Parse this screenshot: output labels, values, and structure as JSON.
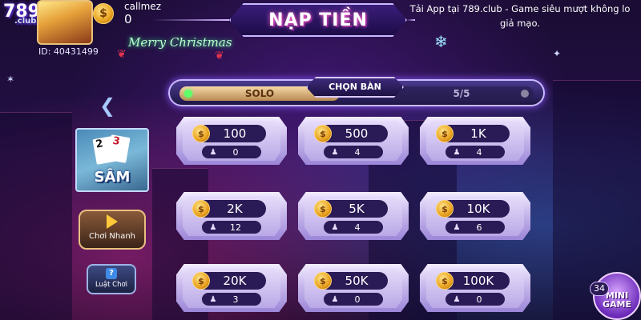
{
  "header": {
    "logo_text": "789",
    "logo_sub": ".club",
    "player_id": "ID: 40431499",
    "username": "callmez",
    "balance": "0",
    "coin_symbol": "$",
    "xmas_greeting": "Merry Christmas",
    "title": "NẠP TIỀN",
    "marquee": "Tải App tại 789.club - Game siêu mượt không lo giả mạo."
  },
  "selector": {
    "left_label": "SOLO",
    "center_label": "CHỌN BÀN",
    "right_label": "5/5"
  },
  "left_panel": {
    "game_name": "SÂM",
    "card_a": "2",
    "card_b": "3",
    "quick_play_label": "Chơi Nhanh",
    "rules_label": "Luật Chơi",
    "rules_icon_text": "?"
  },
  "rooms": [
    {
      "bet": "100",
      "players": "0"
    },
    {
      "bet": "500",
      "players": "4"
    },
    {
      "bet": "1K",
      "players": "4"
    },
    {
      "bet": "2K",
      "players": "12"
    },
    {
      "bet": "5K",
      "players": "4"
    },
    {
      "bet": "10K",
      "players": "6"
    },
    {
      "bet": "20K",
      "players": "3"
    },
    {
      "bet": "50K",
      "players": "0"
    },
    {
      "bet": "100K",
      "players": "0"
    }
  ],
  "mini_game": {
    "label_line1": "MINI",
    "label_line2": "GAME",
    "badge": "34"
  },
  "icons": {
    "back": "chevron-left-icon",
    "play": "play-icon",
    "coin": "coin-icon",
    "person": "person-icon",
    "snowflake": "snowflake-icon"
  },
  "colors": {
    "accent": "#c9b8ff",
    "gold": "#e9a21f",
    "tile_dark": "#2a1a55"
  }
}
